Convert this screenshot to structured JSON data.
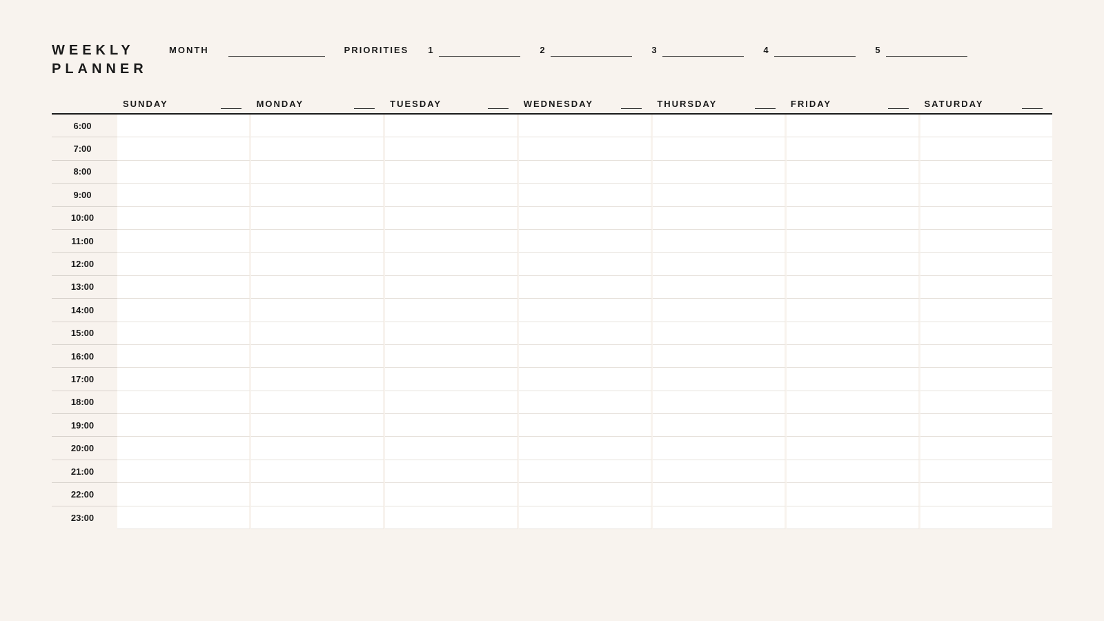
{
  "title_line1": "WEEKLY",
  "title_line2": "PLANNER",
  "month_label": "MONTH",
  "priorities_label": "PRIORITIES",
  "priorities": [
    "1",
    "2",
    "3",
    "4",
    "5"
  ],
  "days": [
    "SUNDAY",
    "MONDAY",
    "TUESDAY",
    "WEDNESDAY",
    "THURSDAY",
    "FRIDAY",
    "SATURDAY"
  ],
  "hours": [
    "6:00",
    "7:00",
    "8:00",
    "9:00",
    "10:00",
    "11:00",
    "12:00",
    "13:00",
    "14:00",
    "15:00",
    "16:00",
    "17:00",
    "18:00",
    "19:00",
    "20:00",
    "21:00",
    "22:00",
    "23:00"
  ]
}
